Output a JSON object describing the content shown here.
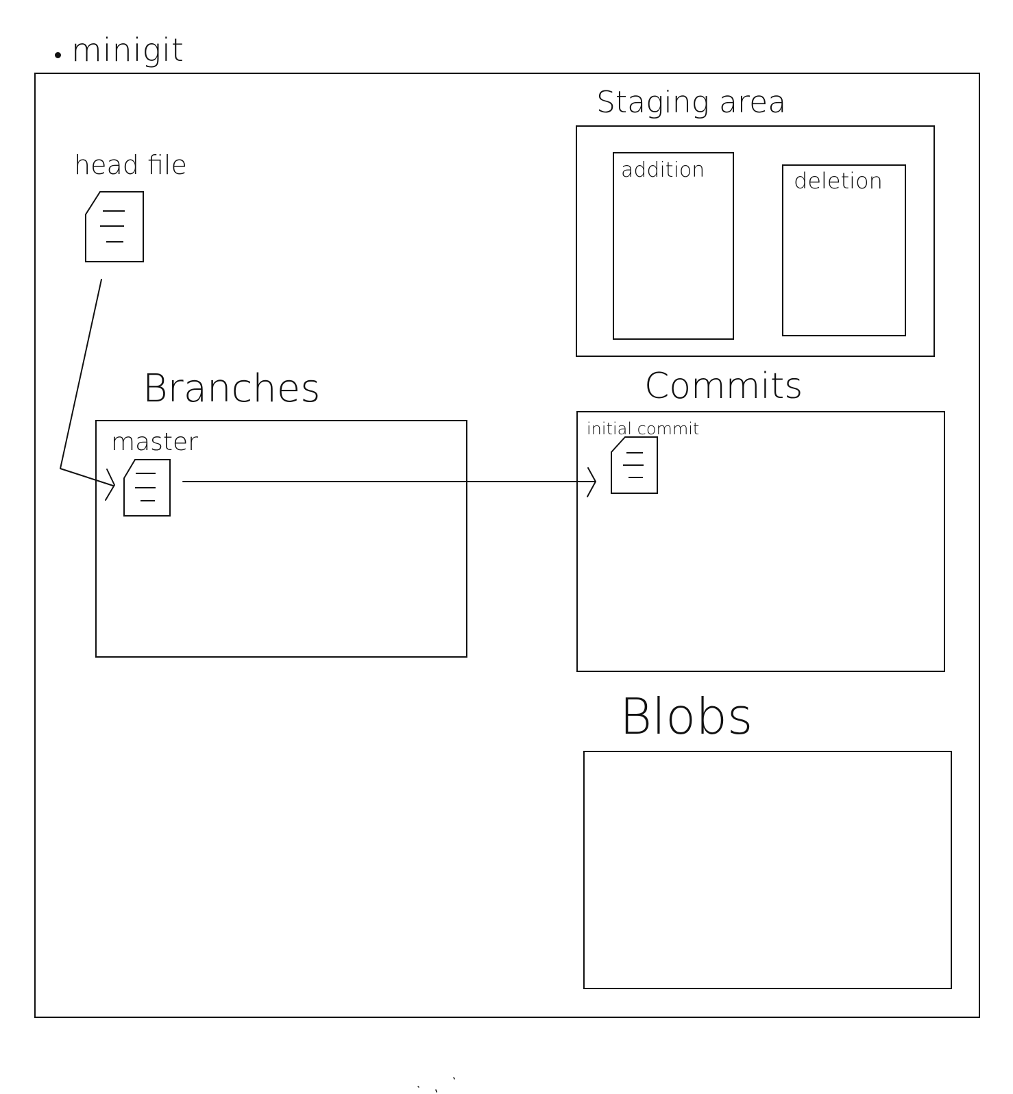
{
  "title": "minigit",
  "labels": {
    "head_file": "head file",
    "staging_area": "Staging area",
    "addition": "addition",
    "deletion": "deletion",
    "branches": "Branches",
    "master": "master",
    "commits": "Commits",
    "initial_commit": "initial commit",
    "blobs": "Blobs"
  },
  "colors": {
    "ink": "#111111",
    "background": "#ffffff"
  },
  "icons": {
    "head_file": "file-icon",
    "master_branch": "file-icon",
    "initial_commit": "file-icon"
  }
}
